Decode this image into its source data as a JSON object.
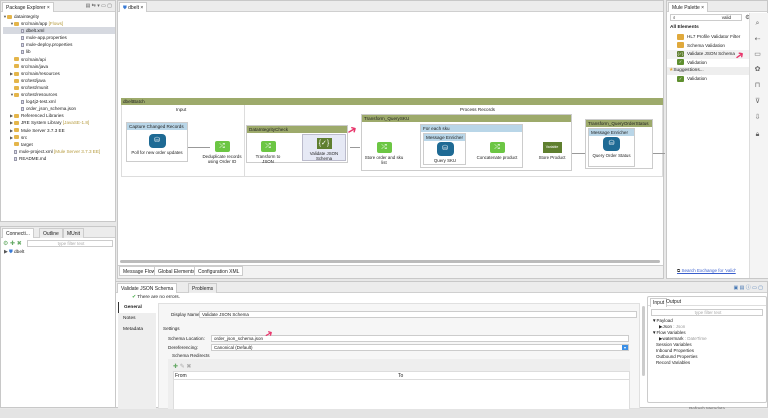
{
  "package_explorer": {
    "title": "Package Explorer",
    "items": [
      {
        "label": "dataintegrity",
        "depth": 0,
        "twisty": "▼",
        "kind": "project"
      },
      {
        "label": "src/main/app",
        "extra": "[Flows]",
        "depth": 1,
        "twisty": "▼",
        "kind": "folder"
      },
      {
        "label": "dbelt.xml",
        "depth": 2,
        "kind": "file",
        "selected": true
      },
      {
        "label": "mule-app.properties",
        "depth": 2,
        "kind": "file"
      },
      {
        "label": "mule-deploy.properties",
        "depth": 2,
        "kind": "file"
      },
      {
        "label": "lib",
        "depth": 2,
        "kind": "file"
      },
      {
        "label": "src/main/api",
        "depth": 1,
        "kind": "folder"
      },
      {
        "label": "src/main/java",
        "depth": 1,
        "kind": "folder"
      },
      {
        "label": "src/main/resources",
        "depth": 1,
        "twisty": "▶",
        "kind": "folder"
      },
      {
        "label": "src/test/java",
        "depth": 1,
        "kind": "folder"
      },
      {
        "label": "src/test/munit",
        "depth": 1,
        "kind": "folder"
      },
      {
        "label": "src/test/resources",
        "depth": 1,
        "twisty": "▼",
        "kind": "folder"
      },
      {
        "label": "log4j2-test.xml",
        "depth": 2,
        "kind": "file"
      },
      {
        "label": "order_json_schema.json",
        "depth": 2,
        "kind": "file"
      },
      {
        "label": "Referenced Libraries",
        "depth": 1,
        "twisty": "▶",
        "kind": "folder"
      },
      {
        "label": "JRE System Library",
        "extra": "[JavaSE-1.8]",
        "depth": 1,
        "twisty": "▶",
        "kind": "folder"
      },
      {
        "label": "Mule Server 3.7.3 EE",
        "depth": 1,
        "twisty": "▶",
        "kind": "folder"
      },
      {
        "label": "src",
        "depth": 1,
        "twisty": "▶",
        "kind": "folder"
      },
      {
        "label": "target",
        "depth": 1,
        "kind": "folder"
      },
      {
        "label": "mule-project.xml",
        "extra": "[Mule Server 3.7.3 EE]",
        "depth": 1,
        "kind": "file"
      },
      {
        "label": "README.md",
        "depth": 1,
        "kind": "file"
      }
    ]
  },
  "connections": {
    "tabs": [
      "Connecti...",
      "Outline",
      "MUnit"
    ],
    "filter_placeholder": "type filter text",
    "items": [
      "dbelt"
    ]
  },
  "editor": {
    "tab": "dbelt",
    "bottom_tabs": [
      "Message Flow",
      "Global Elements",
      "Configuration XML"
    ],
    "flow": {
      "name": "dbeltBatch",
      "input_label": "Input",
      "process_label": "Process Records",
      "capture_scope": "Capture Changed Records",
      "poll": "Poll for new order updates",
      "dedupe": "Deduplicate records using Order ID",
      "dic_scope": "DataIntegrityCheck",
      "transform_json": "Transform to JSON",
      "validate": "Validate JSON Schema",
      "qsku_scope": "Transform_QuerySKU",
      "store_order": "Store order and sku list",
      "foreach_scope": "For each sku",
      "enricher1": "Message Enricher",
      "query_sku": "Query SKU",
      "concat": "Concatenate product",
      "variable_badge": "Variable",
      "store_product": "Store Product",
      "qos_scope": "Transform_QueryOrderStatus",
      "enricher2": "Message Enricher",
      "query_status": "Query Order Status"
    }
  },
  "palette": {
    "title": "Mule Palette",
    "search_value": "valid",
    "section": "All Elements",
    "items": [
      {
        "label": "HL7 Profile Validator Filter",
        "color": "#e0a93c"
      },
      {
        "label": "Schema Validation",
        "color": "#e0a93c"
      },
      {
        "label": "Validate JSON Schema",
        "color": "#5f7f2f",
        "icon": "{✓}"
      },
      {
        "label": "Validation",
        "color": "#5f8f2f",
        "icon": "✓"
      }
    ],
    "suggestions": "Suggestions...",
    "suggestion_items": [
      {
        "label": "Validation",
        "color": "#5f8f2f",
        "icon": "✓"
      }
    ],
    "exchange_link": "Search Exchange for 'valid'"
  },
  "properties": {
    "tabs": [
      "Validate JSON Schema",
      "Problems"
    ],
    "status": "There are no errors.",
    "side_tabs": [
      "General",
      "Notes",
      "Metadata"
    ],
    "display_name_label": "Display Name:",
    "display_name": "Validate JSON Schema",
    "settings": "Settings",
    "schema_location_label": "Schema Location:",
    "schema_location": "order_json_schema.json",
    "dereferencing_label": "Dereferencing:",
    "dereferencing": "Canonical (Default)",
    "redirects": "Schema Redirects",
    "columns": [
      "From",
      "To"
    ]
  },
  "metadata": {
    "tabs": [
      "Input",
      "Output"
    ],
    "filter_placeholder": "type filter text",
    "tree": [
      {
        "label": "▼Payload",
        "depth": 0
      },
      {
        "label": "▶Json",
        "type": ": Json",
        "depth": 1
      },
      {
        "label": "▼Flow Variables",
        "depth": 0
      },
      {
        "label": "▶watermark",
        "type": ": DateTime",
        "depth": 1
      },
      {
        "label": "Session Variables",
        "depth": 0
      },
      {
        "label": "Inbound Properties",
        "depth": 0
      },
      {
        "label": "Outbound Properties",
        "depth": 0
      },
      {
        "label": "Record Variables",
        "depth": 0
      }
    ],
    "refresh": "Refresh Metadata"
  },
  "colors": {
    "olive": "#9daa6b",
    "arrow": "#e8356b",
    "link": "#3a5fcd"
  }
}
